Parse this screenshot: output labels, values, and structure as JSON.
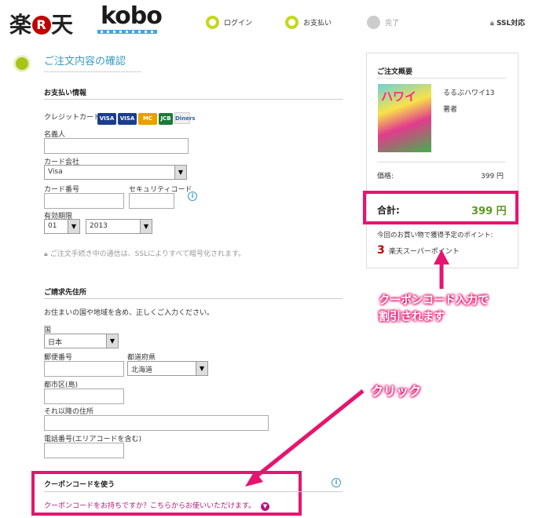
{
  "header": {
    "brand": "楽天",
    "brand_r": "R",
    "kobo": "kobo",
    "steps": [
      {
        "label": "ログイン"
      },
      {
        "label": "お支払い"
      },
      {
        "label": "完了"
      }
    ],
    "ssl": "SSL対応"
  },
  "page_title": "ご注文内容の確認",
  "payment": {
    "title": "お支払い情報",
    "credit_card_label": "クレジットカード",
    "card_brands": [
      "VISA",
      "VISA",
      "MC",
      "JCB",
      "Diners"
    ],
    "name_label": "名義人",
    "card_company_label": "カード会社",
    "card_company_value": "Visa",
    "card_number_label": "カード番号",
    "security_code_label": "セキュリティコード",
    "expiry_label": "有効期限",
    "expiry_month": "01",
    "expiry_year": "2013",
    "ssl_note": "ご注文手続き中の通信は、SSLによりすべて暗号化されます。"
  },
  "billing": {
    "title": "ご請求先住所",
    "note": "お住まいの国や地域を含め、正しくご入力ください。",
    "country_label": "国",
    "country_value": "日本",
    "zip_label": "郵便番号",
    "prefecture_label": "都道府県",
    "prefecture_value": "北海道",
    "city_label": "都市区(島)",
    "address_label": "それ以降の住所",
    "phone_label": "電話番号(エリアコードを含む)"
  },
  "coupon": {
    "title": "クーポンコードを使う",
    "link": "クーポンコードをお持ちですか？こちらからお使いいただけます。"
  },
  "summary": {
    "title": "ご注文概要",
    "cover_text": "ハワイ",
    "book_title": "るるぶハワイ13",
    "author": "著者",
    "price_label": "価格:",
    "price_value": "399 円",
    "total_label": "合計:",
    "total_value": "399 円",
    "points_note": "今回のお買い物で獲得予定のポイント:",
    "points_value": "3",
    "points_suffix": "楽天スーパーポイント"
  },
  "annotations": {
    "coupon_callout_line1": "クーポンコード入力で",
    "coupon_callout_line2": "割引されます",
    "click_callout": "クリック",
    "highlight_color": "#e5156f"
  },
  "colors": {
    "accent_green": "#c5d71b",
    "title_blue": "#3a9bbf",
    "price_green": "#5a9a1c",
    "brand_red": "#bf0000"
  }
}
